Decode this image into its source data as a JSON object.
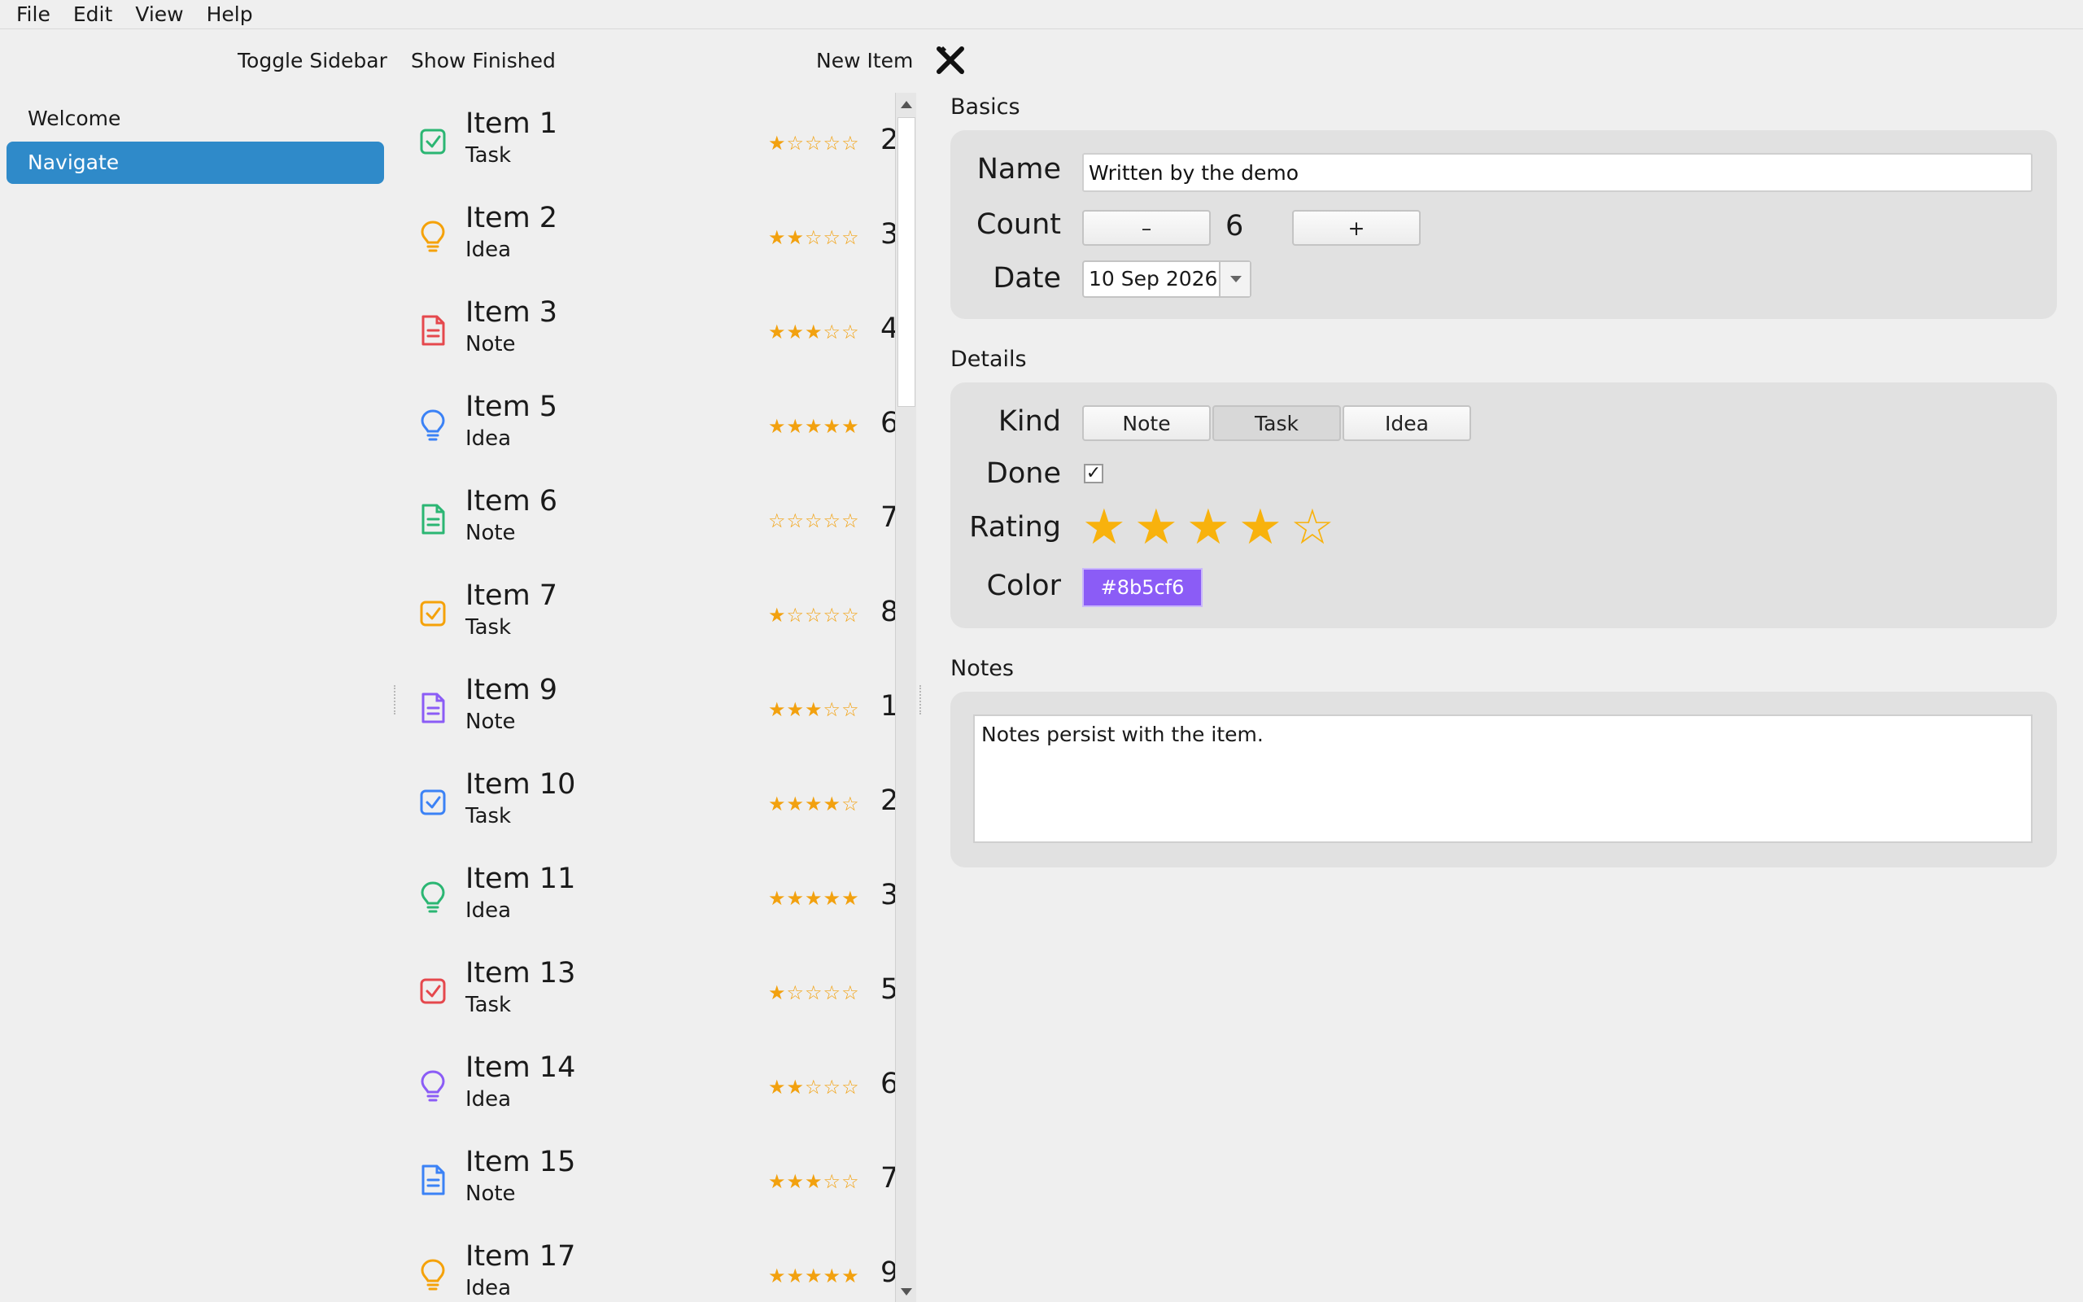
{
  "menubar": {
    "items": [
      "File",
      "Edit",
      "View",
      "Help"
    ]
  },
  "toolbar": {
    "toggle_sidebar": "Toggle Sidebar",
    "show_finished": "Show Finished",
    "new_item": "New Item"
  },
  "sidebar": {
    "items": [
      {
        "label": "Welcome"
      },
      {
        "label": "Navigate",
        "selected": true
      }
    ]
  },
  "list": {
    "items": [
      {
        "title": "Item 1",
        "kind": "Task",
        "rating": 1,
        "count": "2",
        "color": "#2bb673"
      },
      {
        "title": "Item 2",
        "kind": "Idea",
        "rating": 2,
        "count": "3",
        "color": "#f5a20a"
      },
      {
        "title": "Item 3",
        "kind": "Note",
        "rating": 3,
        "count": "4",
        "color": "#e5484d"
      },
      {
        "title": "Item 5",
        "kind": "Idea",
        "rating": 5,
        "count": "6",
        "color": "#3b82f6"
      },
      {
        "title": "Item 6",
        "kind": "Note",
        "rating": 0,
        "count": "7",
        "color": "#2bb673"
      },
      {
        "title": "Item 7",
        "kind": "Task",
        "rating": 1,
        "count": "8",
        "color": "#f5a20a"
      },
      {
        "title": "Item 9",
        "kind": "Note",
        "rating": 3,
        "count": "1",
        "color": "#8b5cf6"
      },
      {
        "title": "Item 10",
        "kind": "Task",
        "rating": 4,
        "count": "2",
        "color": "#3b82f6"
      },
      {
        "title": "Item 11",
        "kind": "Idea",
        "rating": 5,
        "count": "3",
        "color": "#2bb673"
      },
      {
        "title": "Item 13",
        "kind": "Task",
        "rating": 1,
        "count": "5",
        "color": "#e5484d"
      },
      {
        "title": "Item 14",
        "kind": "Idea",
        "rating": 2,
        "count": "6",
        "color": "#8b5cf6"
      },
      {
        "title": "Item 15",
        "kind": "Note",
        "rating": 3,
        "count": "7",
        "color": "#3b82f6"
      },
      {
        "title": "Item 17",
        "kind": "Idea",
        "rating": 5,
        "count": "9",
        "color": "#f5a20a"
      }
    ]
  },
  "detail": {
    "basics": {
      "section_label": "Basics",
      "name_label": "Name",
      "name_value": "Written by the demo",
      "count_label": "Count",
      "count_minus": "–",
      "count_value": "6",
      "count_plus": "+",
      "date_label": "Date",
      "date_value": "10 Sep 2026"
    },
    "details": {
      "section_label": "Details",
      "kind_label": "Kind",
      "kind_options": [
        "Note",
        "Task",
        "Idea"
      ],
      "kind_selected": "Task",
      "done_label": "Done",
      "done_checked": true,
      "done_mark": "✓",
      "rating_label": "Rating",
      "rating_value": 4,
      "rating_max": 5,
      "color_label": "Color",
      "color_value": "#8b5cf6",
      "color_text": "#8b5cf6"
    },
    "notes": {
      "section_label": "Notes",
      "text": "Notes persist with the item."
    }
  },
  "colors": {
    "accent": "#2f8ac9",
    "star": "#f8b20d"
  },
  "icons": {
    "close": "close-x-icon",
    "task": "check-square-icon",
    "idea": "lightbulb-icon",
    "note": "document-icon"
  }
}
